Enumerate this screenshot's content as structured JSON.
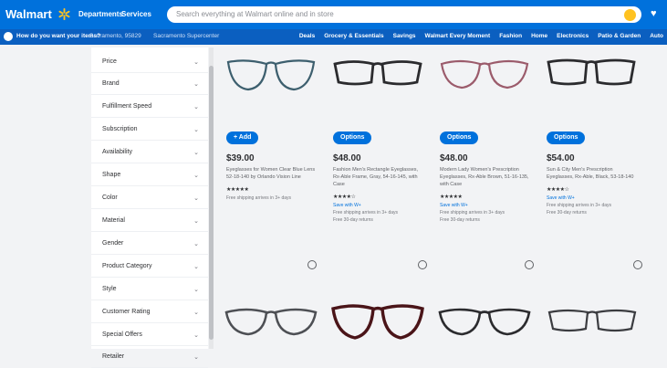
{
  "header": {
    "logo": "Walmart",
    "nav": [
      "Departments",
      "Services"
    ],
    "search_placeholder": "Search everything at Walmart online and in store",
    "cart_icon": "cart-icon"
  },
  "subheader": {
    "deliver_prompt": "How do you want your items?",
    "location": "Sacramento, 95829",
    "store_note": "Sacramento Supercenter",
    "categories": [
      "Deals",
      "Grocery & Essentials",
      "Savings",
      "Walmart Every Moment",
      "Fashion",
      "Home",
      "Electronics",
      "Patio & Garden",
      "Auto"
    ]
  },
  "filters": [
    "Price",
    "Brand",
    "Fulfillment Speed",
    "Subscription",
    "Availability",
    "Shape",
    "Color",
    "Material",
    "Gender",
    "Product Category",
    "Style",
    "Customer Rating",
    "Special Offers",
    "Retailer"
  ],
  "products": [
    {
      "action": "+ Add",
      "price": "$39.00",
      "desc": "Eyeglasses for Women Clear Blue Lens 52-18-140 by Orlando Vision Line",
      "stars": "★★★★★",
      "notes": [
        "Free shipping arrives in 3+ days"
      ]
    },
    {
      "action": "Options",
      "price": "$48.00",
      "desc": "Fashion Men's Rectangle Eyeglasses, Rx-Able Frame, Gray, 54-16-145, with Case",
      "stars": "★★★★☆",
      "notes": [
        "Save with W+",
        "Free shipping arrives in 3+ days",
        "Free 30-day returns"
      ]
    },
    {
      "action": "Options",
      "price": "$48.00",
      "desc": "Modern Lady Women's Prescription Eyeglasses, Rx-Able Brown, 51-16-135, with Case",
      "stars": "★★★★★",
      "notes": [
        "Save with W+",
        "Free shipping arrives in 3+ days",
        "Free 30-day returns"
      ]
    },
    {
      "action": "Options",
      "price": "$54.00",
      "desc": "Sun & City Men's Prescription Eyeglasses, Rx-Able, Black, 53-18-140",
      "stars": "★★★★☆",
      "notes": [
        "Save with W+",
        "Free shipping arrives in 3+ days",
        "Free 30-day returns"
      ]
    }
  ],
  "colors": {
    "brand_blue": "#0071dc",
    "yellow": "#ffc220",
    "frame_teal": "#3d5f6e",
    "frame_black": "#2b2b2e",
    "frame_pink": "#9b5b6b",
    "frame_red": "#4a1418"
  }
}
